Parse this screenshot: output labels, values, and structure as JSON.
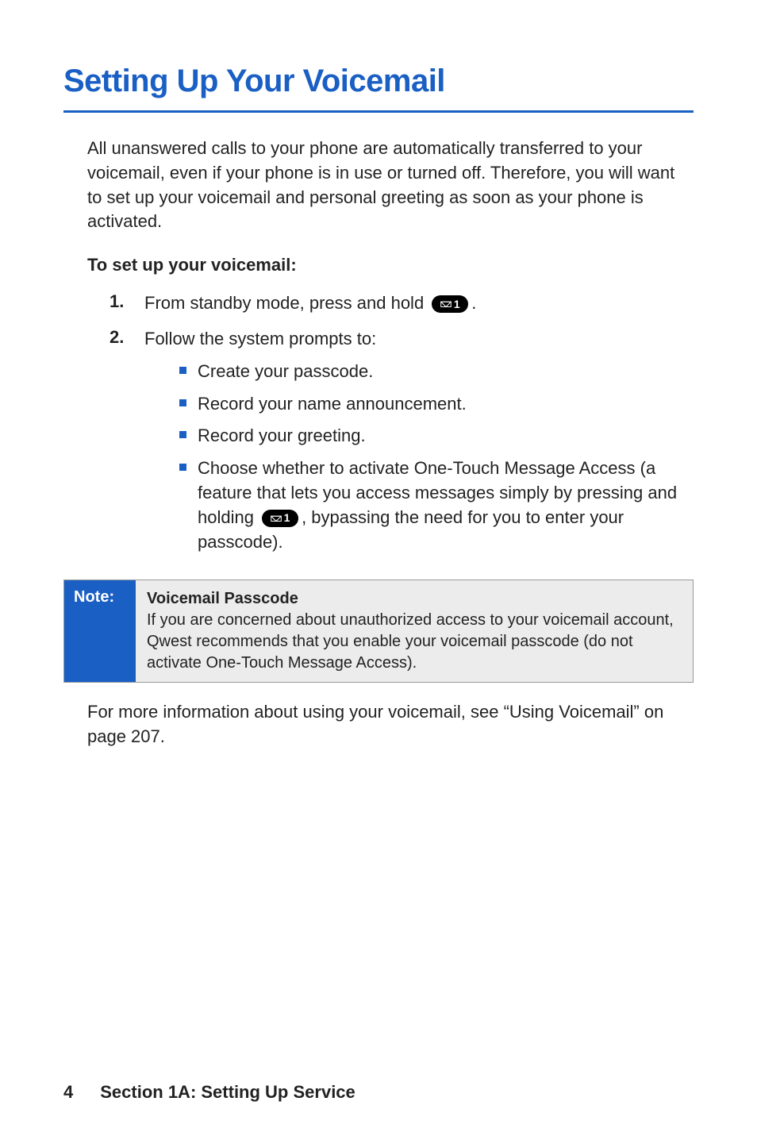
{
  "title": "Setting Up Your Voicemail",
  "intro": "All unanswered calls to your phone are automatically transferred to your voicemail, even if your phone is in use or turned off. Therefore, you will want to set up your voicemail and personal greeting as soon as your phone is activated.",
  "subhead": "To set up your voicemail:",
  "steps": {
    "s1": {
      "num": "1.",
      "pre": "From standby mode, press and hold ",
      "post": "."
    },
    "s2": {
      "num": "2.",
      "text": "Follow the system prompts to:"
    }
  },
  "key": {
    "digit": "1"
  },
  "sublist": {
    "a": "Create your passcode.",
    "b": "Record your name announcement.",
    "c": "Record your greeting.",
    "d_pre": "Choose whether to activate One-Touch Message Access (a feature that lets you access messages simply by pressing and holding ",
    "d_post": ", bypassing the need for you to enter your passcode)."
  },
  "note": {
    "label": "Note:",
    "title": "Voicemail Passcode",
    "body": "If you are concerned about unauthorized access to your voicemail account, Qwest recommends that you enable your voicemail passcode (do not activate One-Touch Message Access)."
  },
  "refline": "For more information about using your voicemail, see “Using Voicemail” on page 207.",
  "footer": {
    "page": "4",
    "section": "Section 1A: Setting Up Service"
  }
}
